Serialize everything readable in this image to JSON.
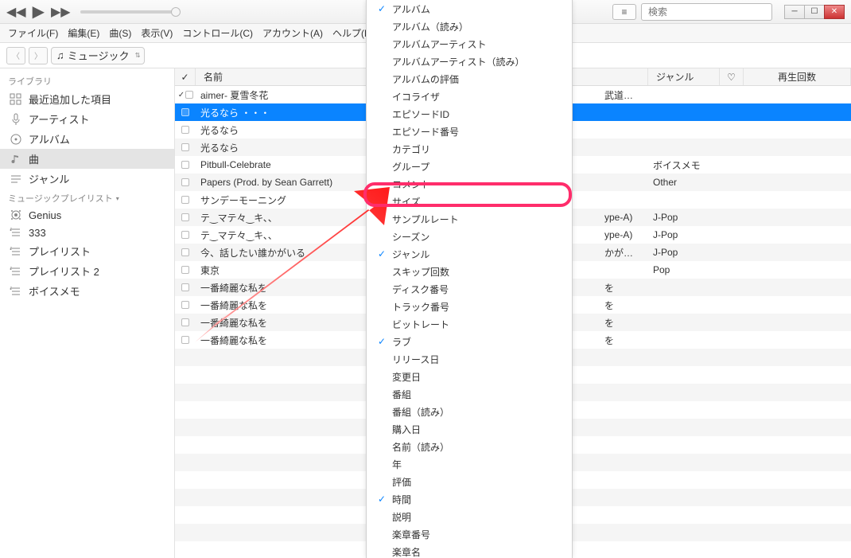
{
  "search": {
    "placeholder": "検索"
  },
  "menus": [
    "ファイル(F)",
    "編集(E)",
    "曲(S)",
    "表示(V)",
    "コントロール(C)",
    "アカウント(A)",
    "ヘルプ(H"
  ],
  "media_selector": {
    "label": "ミュージック"
  },
  "subnav_pill": "ライブラリ",
  "sidebar": {
    "library_header": "ライブラリ",
    "library_items": [
      {
        "icon": "grid",
        "label": "最近追加した項目"
      },
      {
        "icon": "mic",
        "label": "アーティスト"
      },
      {
        "icon": "disc",
        "label": "アルバム"
      },
      {
        "icon": "note",
        "label": "曲",
        "selected": true
      },
      {
        "icon": "bars",
        "label": "ジャンル"
      }
    ],
    "playlists_header": "ミュージックプレイリスト",
    "playlist_items": [
      {
        "icon": "genius",
        "label": "Genius"
      },
      {
        "icon": "list",
        "label": "333"
      },
      {
        "icon": "list",
        "label": "プレイリスト"
      },
      {
        "icon": "list",
        "label": "プレイリスト 2"
      },
      {
        "icon": "list",
        "label": "ボイスメモ"
      }
    ]
  },
  "columns": {
    "name_header": "名前",
    "genre_header": "ジャンル",
    "plays_header": "再生回数"
  },
  "songs": [
    {
      "checked": true,
      "name": "aimer- 夏雪冬花",
      "selected": false
    },
    {
      "checked": false,
      "name": "光るなら ・・・",
      "selected": true
    },
    {
      "checked": false,
      "name": "光るなら",
      "selected": false
    },
    {
      "checked": false,
      "name": "光るなら",
      "selected": false
    },
    {
      "checked": false,
      "name": "Pitbull-Celebrate",
      "selected": false
    },
    {
      "checked": false,
      "name": "Papers (Prod. by Sean Garrett)",
      "selected": false
    },
    {
      "checked": false,
      "name": "サンデーモーニング",
      "selected": false
    },
    {
      "checked": false,
      "name": "テ‿マテ々‿キ、、",
      "selected": false
    },
    {
      "checked": false,
      "name": "テ‿マテ々‿キ、、",
      "selected": false
    },
    {
      "checked": false,
      "name": "今、話したい誰かがいる",
      "selected": false
    },
    {
      "checked": false,
      "name": "東京",
      "selected": false
    },
    {
      "checked": false,
      "name": "一番綺麗な私を",
      "selected": false
    },
    {
      "checked": false,
      "name": "一番綺麗な私を",
      "selected": false
    },
    {
      "checked": false,
      "name": "一番綺麗な私を",
      "selected": false
    },
    {
      "checked": false,
      "name": "一番綺麗な私を",
      "selected": false
    }
  ],
  "right_fragments": [
    {
      "album": "武道…",
      "genre": ""
    },
    {
      "album": "",
      "genre": ""
    },
    {
      "album": "",
      "genre": ""
    },
    {
      "album": "",
      "genre": ""
    },
    {
      "album": "",
      "genre": "ボイスメモ"
    },
    {
      "album": "",
      "genre": "Other"
    },
    {
      "album": "",
      "genre": ""
    },
    {
      "album": "ype-A)",
      "genre": "J-Pop"
    },
    {
      "album": "ype-A)",
      "genre": "J-Pop"
    },
    {
      "album": "かが…",
      "genre": "J-Pop"
    },
    {
      "album": "",
      "genre": "Pop"
    },
    {
      "album": "を",
      "genre": ""
    },
    {
      "album": "を",
      "genre": ""
    },
    {
      "album": "を",
      "genre": ""
    },
    {
      "album": "を",
      "genre": ""
    }
  ],
  "dropdown_items": [
    {
      "checked": true,
      "label": "アルバム"
    },
    {
      "checked": false,
      "label": "アルバム（読み）"
    },
    {
      "checked": false,
      "label": "アルバムアーティスト"
    },
    {
      "checked": false,
      "label": "アルバムアーティスト（読み）"
    },
    {
      "checked": false,
      "label": "アルバムの評価"
    },
    {
      "checked": false,
      "label": "イコライザ"
    },
    {
      "checked": false,
      "label": "エピソードID"
    },
    {
      "checked": false,
      "label": "エピソード番号"
    },
    {
      "checked": false,
      "label": "カテゴリ"
    },
    {
      "checked": false,
      "label": "グループ"
    },
    {
      "checked": false,
      "label": "コメント"
    },
    {
      "checked": false,
      "label": "サイズ",
      "highlighted": true
    },
    {
      "checked": false,
      "label": "サンプルレート"
    },
    {
      "checked": false,
      "label": "シーズン"
    },
    {
      "checked": true,
      "label": "ジャンル"
    },
    {
      "checked": false,
      "label": "スキップ回数"
    },
    {
      "checked": false,
      "label": "ディスク番号"
    },
    {
      "checked": false,
      "label": "トラック番号"
    },
    {
      "checked": false,
      "label": "ビットレート"
    },
    {
      "checked": true,
      "label": "ラブ"
    },
    {
      "checked": false,
      "label": "リリース日"
    },
    {
      "checked": false,
      "label": "変更日"
    },
    {
      "checked": false,
      "label": "番組"
    },
    {
      "checked": false,
      "label": "番組（読み）"
    },
    {
      "checked": false,
      "label": "購入日"
    },
    {
      "checked": false,
      "label": "名前（読み）"
    },
    {
      "checked": false,
      "label": "年"
    },
    {
      "checked": false,
      "label": "評価"
    },
    {
      "checked": true,
      "label": "時間"
    },
    {
      "checked": false,
      "label": "説明"
    },
    {
      "checked": false,
      "label": "楽章番号"
    },
    {
      "checked": false,
      "label": "楽章名"
    }
  ]
}
